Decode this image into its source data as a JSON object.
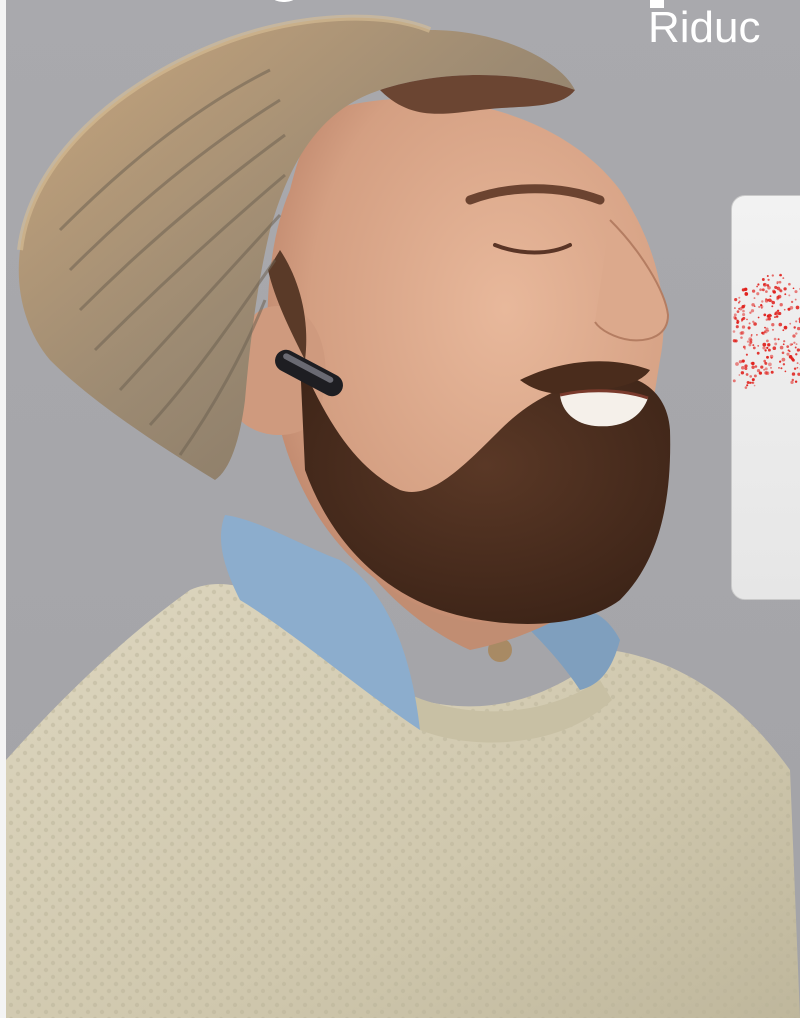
{
  "headline": {
    "text": "Riduc"
  },
  "colors": {
    "background": "#a7a7ab",
    "headline": "#ffffff",
    "card": "#ececec",
    "noise_dots": "#e0201c",
    "sweater": "#d2cbb2",
    "beanie": "#8a7b68",
    "collar": "#8aabcb",
    "beard": "#4b2e1e",
    "skin": "#dba88c"
  },
  "icons": {
    "earbud": "earbud-icon"
  }
}
